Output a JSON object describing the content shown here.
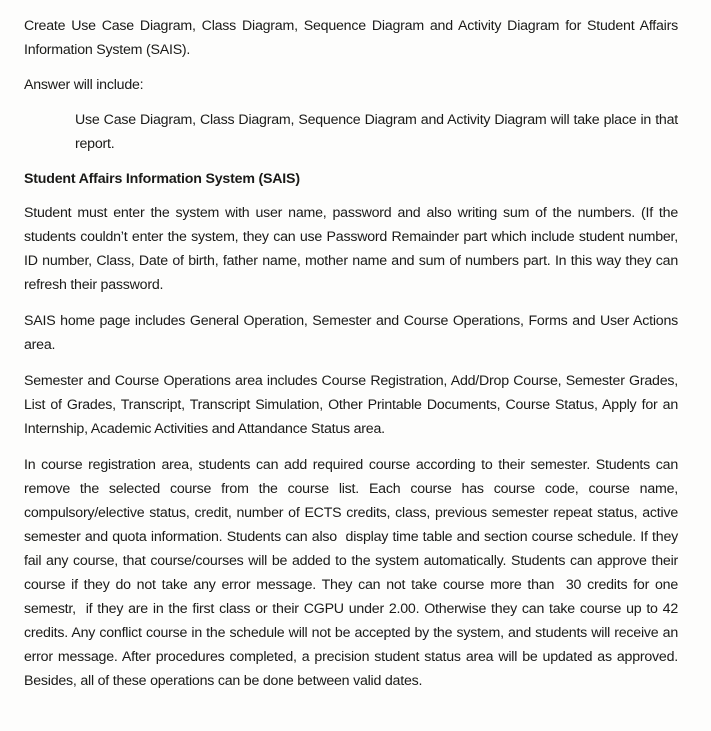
{
  "document": {
    "background_color": "#fdfdfc",
    "text_color": "#1a1a18",
    "blocks": {
      "prompt": "Create Use Case Diagram, Class Diagram, Sequence Diagram and Activity Diagram for Student Affairs Information System (SAIS).",
      "answer_intro": "Answer will include:",
      "answer_detail": "Use Case Diagram, Class Diagram, Sequence Diagram and Activity Diagram will take place in that report.",
      "heading": "Student Affairs Information System (SAIS)",
      "login_paragraph": "Student must enter the system with user name, password and also writing sum of the numbers. (If the students couldn’t enter the system, they can use Password Remainder part which include student number, ID number, Class, Date of birth, father name, mother name and sum of numbers part. In this way they can refresh their password.",
      "home_page_paragraph": "SAIS home page includes General Operation, Semester and Course Operations, Forms and User Actions area.",
      "semester_operations_paragraph": "Semester and Course Operations area includes Course Registration, Add/Drop Course, Semester Grades, List of Grades, Transcript, Transcript Simulation, Other Printable Documents, Course Status, Apply for an Internship, Academic Activities and Attandance Status area.",
      "course_registration_paragraph": "In course registration area, students can add required course according to their semester. Students can remove the selected course from the course list. Each course has course code, course name, compulsory/elective status, credit, number of ECTS credits, class, previous semester repeat status, active semester and quota information. Students can also  display time table and section course schedule. If they fail any course, that course/courses will be added to the system automatically. Students can approve their course if they do not take any error message. They can not take course more than  30 credits for one semestr,  if they are in the first class or their CGPU under 2.00. Otherwise they can take course up to 42 credits. Any conflict course in the schedule will not be accepted by the system, and students will receive an error message. After procedures completed, a precision student status area will be updated as approved. Besides, all of these operations can be done between valid dates."
    }
  }
}
